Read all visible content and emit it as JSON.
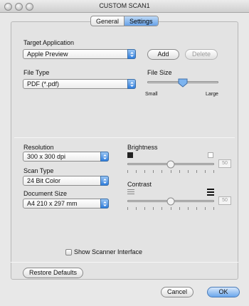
{
  "window": {
    "title": "CUSTOM SCAN1"
  },
  "tabs": [
    {
      "label": "General",
      "active": false
    },
    {
      "label": "Settings",
      "active": true
    }
  ],
  "target_application": {
    "label": "Target Application",
    "value": "Apple Preview",
    "add_label": "Add",
    "delete_label": "Delete"
  },
  "file_type": {
    "label": "File Type",
    "value": "PDF (*.pdf)"
  },
  "file_size": {
    "label": "File Size",
    "min_label": "Small",
    "max_label": "Large",
    "level": 0.5
  },
  "resolution": {
    "label": "Resolution",
    "value": "300 x 300 dpi"
  },
  "scan_type": {
    "label": "Scan Type",
    "value": "24 Bit Color"
  },
  "document_size": {
    "label": "Document Size",
    "value": "A4  210 x 297 mm"
  },
  "brightness": {
    "label": "Brightness",
    "value": "50",
    "level": 0.5
  },
  "contrast": {
    "label": "Contrast",
    "value": "50",
    "level": 0.5
  },
  "show_scanner_interface": {
    "label": "Show Scanner Interface",
    "checked": false
  },
  "buttons": {
    "restore_defaults": "Restore Defaults",
    "cancel": "Cancel",
    "ok": "OK"
  },
  "colors": {
    "accent": "#5a9ae6",
    "default_button": "#6aa7ec"
  }
}
